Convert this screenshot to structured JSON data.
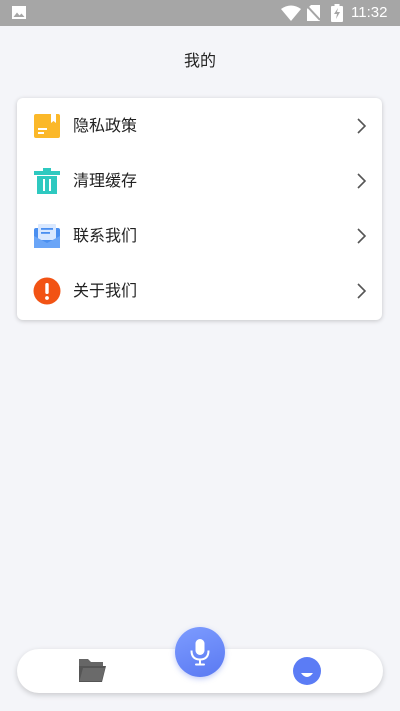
{
  "status_bar": {
    "time": "11:32",
    "icons": [
      "gallery-icon",
      "wifi-icon",
      "no-sim-icon",
      "battery-charging-icon"
    ]
  },
  "page": {
    "title": "我的"
  },
  "menu": {
    "items": [
      {
        "label": "隐私政策",
        "icon": "document-icon",
        "icon_color": "#fbb829"
      },
      {
        "label": "清理缓存",
        "icon": "trash-icon",
        "icon_color": "#2ec9c0"
      },
      {
        "label": "联系我们",
        "icon": "mail-icon",
        "icon_color": "#4a8ff0"
      },
      {
        "label": "关于我们",
        "icon": "info-alert-icon",
        "icon_color": "#f25314"
      }
    ],
    "chevron_icon": "chevron-right-icon"
  },
  "bottom_nav": {
    "items": [
      {
        "icon": "folder-icon",
        "color": "#555555"
      },
      {
        "icon": "microphone-icon",
        "color": "#6b8af8"
      },
      {
        "icon": "mine-icon",
        "color": "#5b7cf5"
      }
    ]
  }
}
